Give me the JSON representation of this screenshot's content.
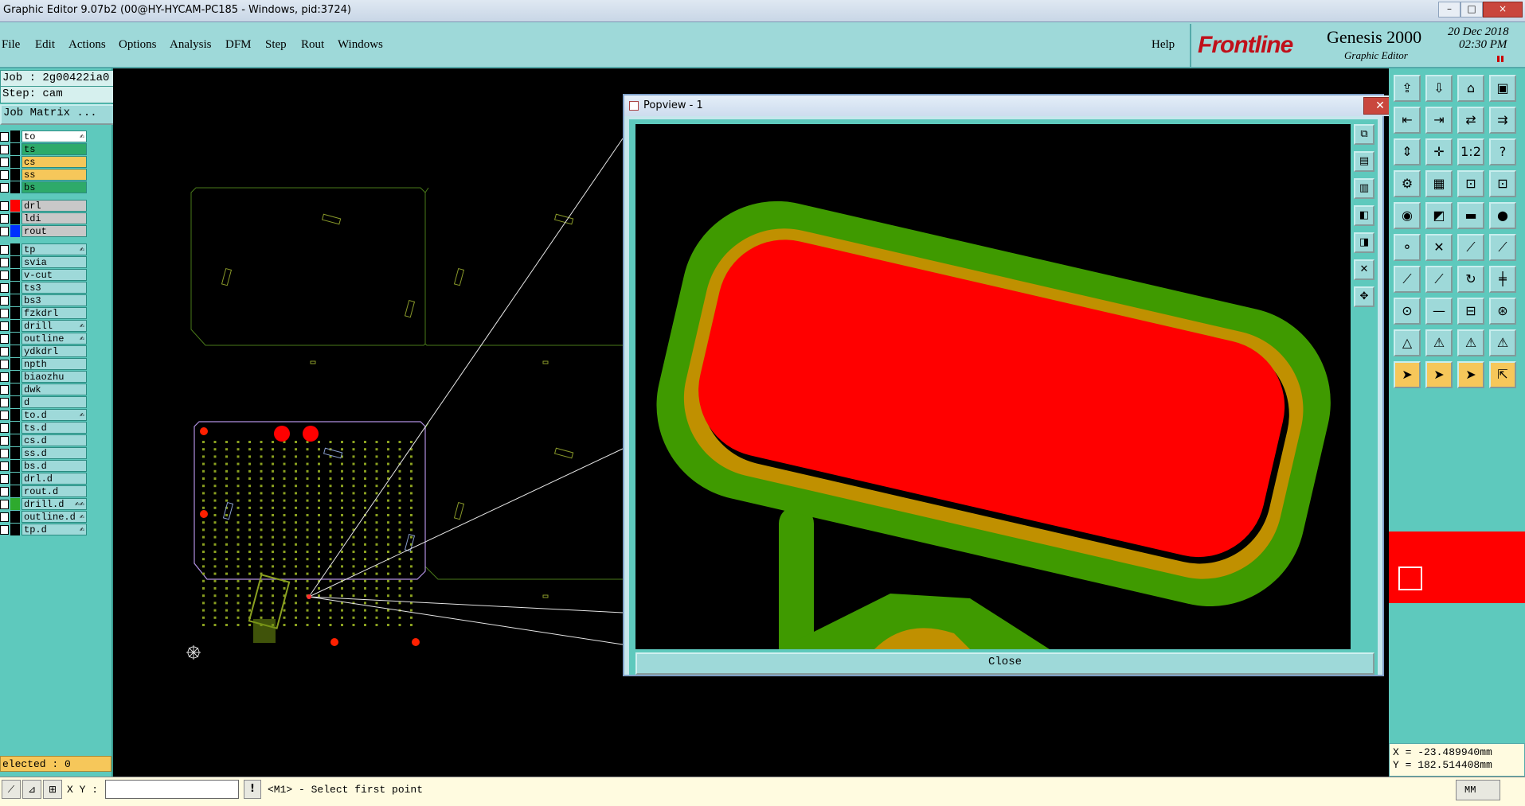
{
  "window": {
    "title": "Graphic Editor 9.07b2 (00@HY-HYCAM-PC185 - Windows, pid:3724)",
    "minimize": "–",
    "maximize": "□",
    "close": "×"
  },
  "menu": {
    "items": [
      "File",
      "Edit",
      "Actions",
      "Options",
      "Analysis",
      "DFM",
      "Step",
      "Rout",
      "Windows"
    ],
    "help": "Help"
  },
  "brand": {
    "logo": "Frontline",
    "product": "Genesis 2000",
    "subtitle": "Graphic Editor",
    "date": "20 Dec 2018",
    "time": "02:30 PM"
  },
  "job": {
    "job_label": "Job : 2g00422ia0",
    "step_label": "Step: cam",
    "matrix_button": "Job Matrix ..."
  },
  "layers": [
    {
      "name": "to",
      "color": "#ffffff",
      "swatch": "#000000",
      "flag": "✍"
    },
    {
      "name": "ts",
      "color": "#2eaa6a",
      "swatch": "#000000",
      "flag": ""
    },
    {
      "name": "cs",
      "color": "#f6c75a",
      "swatch": "#000000",
      "flag": ""
    },
    {
      "name": "ss",
      "color": "#f6c75a",
      "swatch": "#000000",
      "flag": ""
    },
    {
      "name": "bs",
      "color": "#2eaa6a",
      "swatch": "#000000",
      "flag": ""
    },
    {
      "name": "drl",
      "color": "#c8c8c8",
      "swatch": "#ff0000",
      "flag": ""
    },
    {
      "name": "ldi",
      "color": "#c8c8c8",
      "swatch": "#000000",
      "flag": ""
    },
    {
      "name": "rout",
      "color": "#c8c8c8",
      "swatch": "#0030ff",
      "flag": ""
    },
    {
      "name": "tp",
      "color": "#9ed9d9",
      "swatch": "#000000",
      "flag": "✍"
    },
    {
      "name": "svia",
      "color": "#9ed9d9",
      "swatch": "#000000",
      "flag": ""
    },
    {
      "name": "v-cut",
      "color": "#9ed9d9",
      "swatch": "#000000",
      "flag": ""
    },
    {
      "name": "ts3",
      "color": "#9ed9d9",
      "swatch": "#000000",
      "flag": ""
    },
    {
      "name": "bs3",
      "color": "#9ed9d9",
      "swatch": "#000000",
      "flag": ""
    },
    {
      "name": "fzkdrl",
      "color": "#9ed9d9",
      "swatch": "#000000",
      "flag": ""
    },
    {
      "name": "drill",
      "color": "#9ed9d9",
      "swatch": "#000000",
      "flag": "✍"
    },
    {
      "name": "outline",
      "color": "#9ed9d9",
      "swatch": "#000000",
      "flag": "✍"
    },
    {
      "name": "ydkdrl",
      "color": "#9ed9d9",
      "swatch": "#000000",
      "flag": ""
    },
    {
      "name": "npth",
      "color": "#9ed9d9",
      "swatch": "#000000",
      "flag": ""
    },
    {
      "name": "biaozhu",
      "color": "#9ed9d9",
      "swatch": "#000000",
      "flag": ""
    },
    {
      "name": "dwk",
      "color": "#9ed9d9",
      "swatch": "#000000",
      "flag": ""
    },
    {
      "name": "d",
      "color": "#9ed9d9",
      "swatch": "#000000",
      "flag": ""
    },
    {
      "name": "to.d",
      "color": "#9ed9d9",
      "swatch": "#000000",
      "flag": "✍"
    },
    {
      "name": "ts.d",
      "color": "#9ed9d9",
      "swatch": "#000000",
      "flag": ""
    },
    {
      "name": "cs.d",
      "color": "#9ed9d9",
      "swatch": "#000000",
      "flag": ""
    },
    {
      "name": "ss.d",
      "color": "#9ed9d9",
      "swatch": "#000000",
      "flag": ""
    },
    {
      "name": "bs.d",
      "color": "#9ed9d9",
      "swatch": "#000000",
      "flag": ""
    },
    {
      "name": "drl.d",
      "color": "#9ed9d9",
      "swatch": "#000000",
      "flag": ""
    },
    {
      "name": "rout.d",
      "color": "#9ed9d9",
      "swatch": "#000000",
      "flag": ""
    },
    {
      "name": "drill.d",
      "color": "#9ed9d9",
      "swatch": "#2eaa2e",
      "flag": "✍✍"
    },
    {
      "name": "outline.d",
      "color": "#9ed9d9",
      "swatch": "#000000",
      "flag": "✍"
    },
    {
      "name": "tp.d",
      "color": "#9ed9d9",
      "swatch": "#000000",
      "flag": "✍"
    }
  ],
  "status": {
    "selected": "elected : 0",
    "xy_label": "X Y :",
    "prompt": "<M1> - Select first point",
    "units": "MM"
  },
  "coords": {
    "x": "X = -23.489940mm",
    "y": "Y = 182.514408mm"
  },
  "popview": {
    "title": "Popview - 1",
    "close_button": "Close"
  },
  "colors": {
    "panel": "#5ec9bd",
    "menubar": "#9ed9d9",
    "pad_red": "#ff0000",
    "ring_green": "#3f9a00",
    "ring_gold": "#c09000"
  }
}
